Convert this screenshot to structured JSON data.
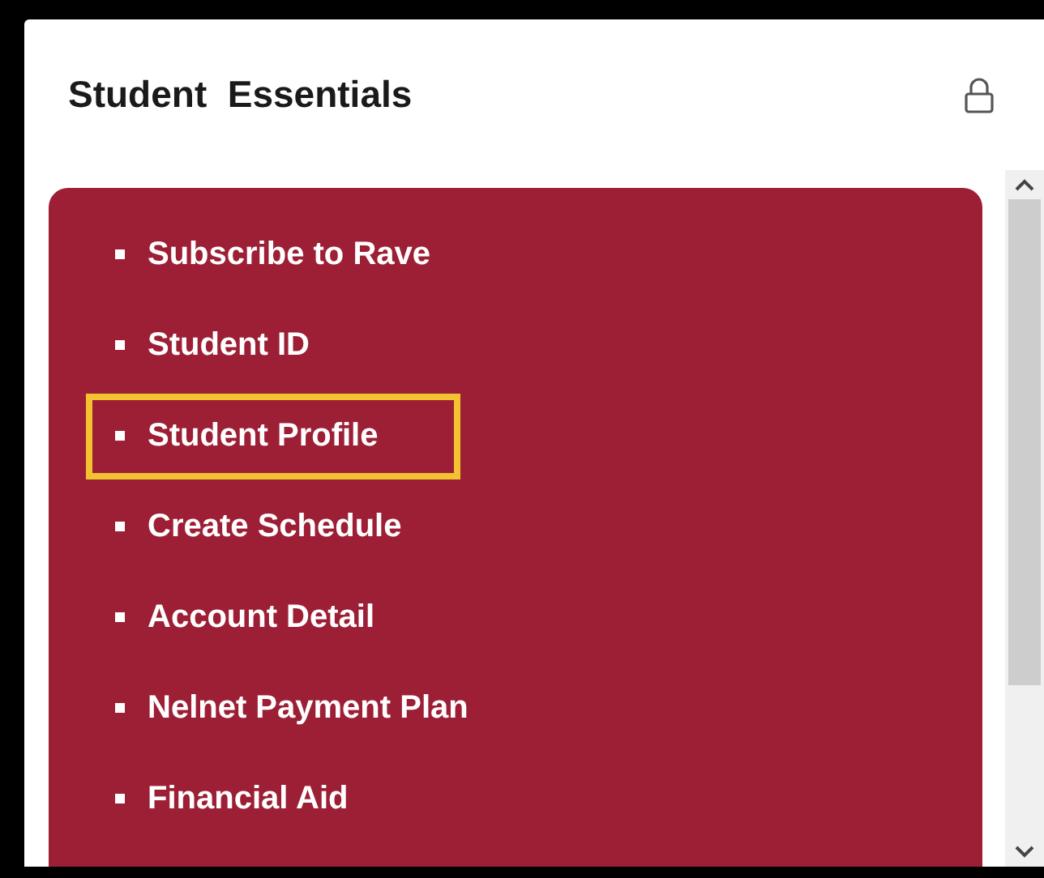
{
  "panel": {
    "title": "Student  Essentials"
  },
  "links": [
    {
      "label": "Subscribe to Rave",
      "highlighted": false
    },
    {
      "label": "Student ID",
      "highlighted": false
    },
    {
      "label": "Student Profile",
      "highlighted": true
    },
    {
      "label": "Create Schedule",
      "highlighted": false
    },
    {
      "label": "Account Detail",
      "highlighted": false
    },
    {
      "label": "Nelnet Payment Plan",
      "highlighted": false
    },
    {
      "label": "Financial Aid",
      "highlighted": false
    }
  ]
}
